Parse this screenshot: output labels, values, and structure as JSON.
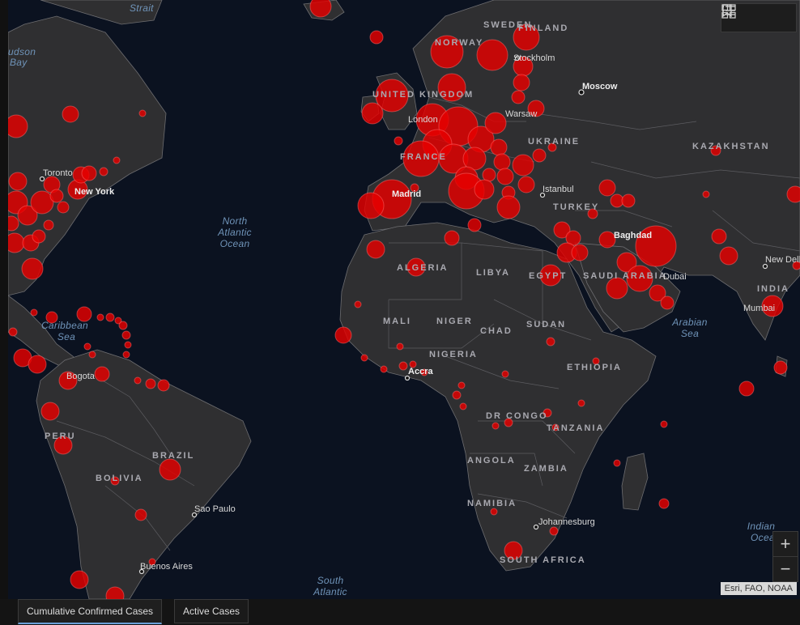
{
  "map": {
    "ocean_labels": [
      {
        "text": "Strait",
        "lines": [
          "Strait"
        ]
      },
      {
        "text": "Hudson Bay",
        "lines": [
          "udson",
          "Bay"
        ]
      },
      {
        "text": "North Atlantic Ocean",
        "lines": [
          "North",
          "Atlantic",
          "Ocean"
        ]
      },
      {
        "text": "Caribbean Sea",
        "lines": [
          "Caribbean",
          "Sea"
        ]
      },
      {
        "text": "Arabian Sea",
        "lines": [
          "Arabian",
          "Sea"
        ]
      },
      {
        "text": "Indian Ocean",
        "lines": [
          "Indian",
          "Ocea"
        ]
      },
      {
        "text": "South Atlantic",
        "lines": [
          "South",
          "Atlantic"
        ]
      }
    ],
    "country_labels": [
      "SWEDEN",
      "FINLAND",
      "NORWAY",
      "UNITED KINGDOM",
      "FRANCE",
      "UKRAINE",
      "KAZAKHSTAN",
      "TURKEY",
      "ALGERIA",
      "LIBYA",
      "EGYPT",
      "SAUDI ARABIA",
      "INDIA",
      "MALI",
      "NIGER",
      "CHAD",
      "SUDAN",
      "NIGERIA",
      "ETHIOPIA",
      "DR CONGO",
      "TANZANIA",
      "ANGOLA",
      "ZAMBIA",
      "NAMIBIA",
      "SOUTH AFRICA",
      "BRAZIL",
      "PERU",
      "BOLIVIA"
    ],
    "city_labels": [
      "Stockholm",
      "Moscow",
      "London",
      "Warsaw",
      "Toronto",
      "New York",
      "Madrid",
      "Istanbul",
      "Baghdad",
      "Dubai",
      "New Delhi",
      "Mumbai",
      "Bogota",
      "Accra",
      "Johannesburg",
      "Sao Paulo",
      "Buenos Aires"
    ],
    "attribution": "Esri, FAO, NOAA",
    "zoom_in": "+",
    "zoom_out": "−"
  },
  "tools": {
    "bookmark_icon": "bookmark-icon",
    "list_icon": "list-icon",
    "basemap_icon": "grid-icon"
  },
  "tabs": [
    {
      "label": "Cumulative Confirmed Cases",
      "active": true
    },
    {
      "label": "Active Cases",
      "active": false
    }
  ],
  "colors": {
    "ocean": "#0b1220",
    "land": "#2f2f31",
    "border": "#6d6d70",
    "bubble": "#e60000"
  }
}
